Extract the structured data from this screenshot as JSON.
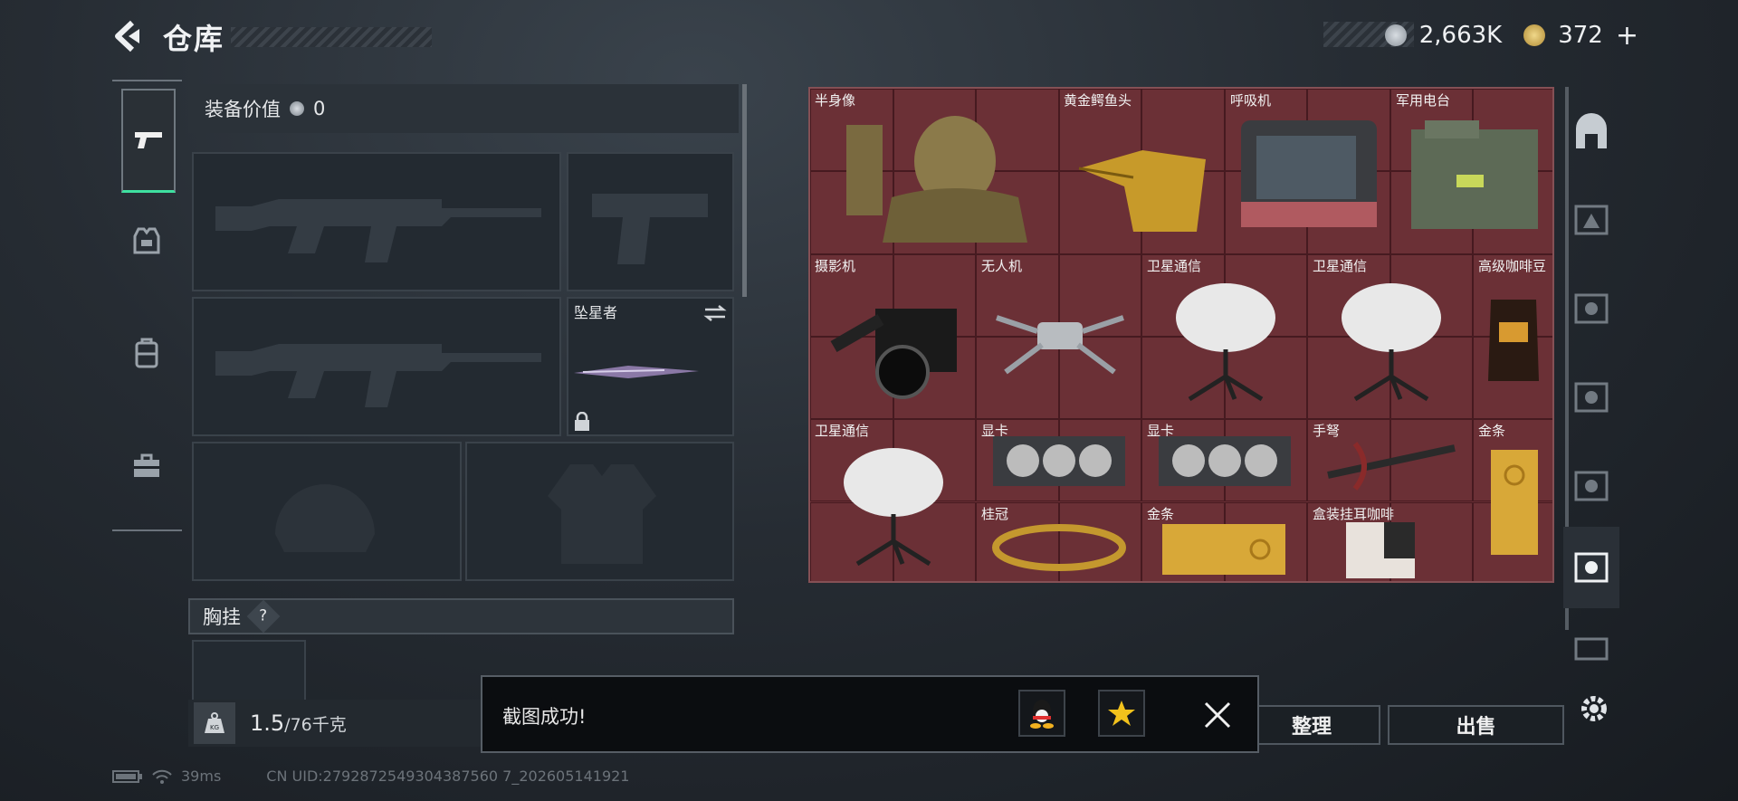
{
  "header": {
    "title": "仓库"
  },
  "currency": {
    "silver": "2,663K",
    "gold": "372",
    "add": "+"
  },
  "loadout": {
    "value_label": "装备价值",
    "value": "0",
    "melee_name": "坠星者",
    "chest_label": "胸挂",
    "chest_help": "?",
    "weight_current": "1.5",
    "weight_max": "/76千克",
    "weight_icon": "KG"
  },
  "stash": {
    "items": [
      {
        "name": "半身像"
      },
      {
        "name": "黄金鳄鱼头"
      },
      {
        "name": "呼吸机"
      },
      {
        "name": "军用电台"
      },
      {
        "name": "摄影机"
      },
      {
        "name": "无人机"
      },
      {
        "name": "卫星通信"
      },
      {
        "name": "卫星通信"
      },
      {
        "name": "高级咖啡豆"
      },
      {
        "name": "卫星通信"
      },
      {
        "name": "显卡"
      },
      {
        "name": "显卡"
      },
      {
        "name": "手弩"
      },
      {
        "name": "金条"
      },
      {
        "name": "桂冠"
      },
      {
        "name": "金条"
      },
      {
        "name": "盒装挂耳咖啡"
      }
    ]
  },
  "actions": {
    "sort": "整理",
    "sell": "出售"
  },
  "toast": {
    "message": "截图成功!"
  },
  "status": {
    "ping": "39ms",
    "uid": "CN UID:2792872549304387560 7_202605141921"
  },
  "colors": {
    "stash_bg": "#6b3036",
    "accent": "#3ee0a0"
  }
}
